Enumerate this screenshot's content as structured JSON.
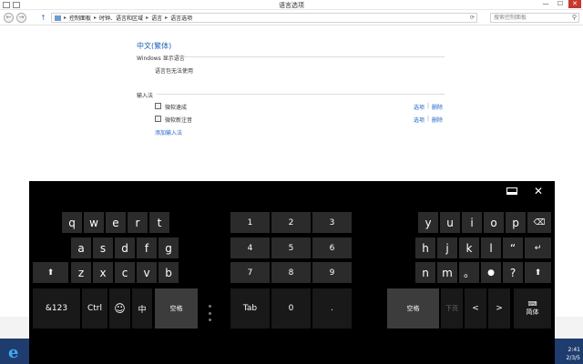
{
  "window": {
    "title": "语言选项",
    "minimize": "—",
    "maximize": "☐",
    "close": "✕"
  },
  "address_bar": {
    "back": "←",
    "forward": "→",
    "up": "↑",
    "crumbs": [
      "控制面板",
      "时钟、语言和区域",
      "语言",
      "语言选项"
    ],
    "separator": "▸",
    "refresh": "⟳",
    "search_placeholder": "搜索控制面板",
    "search_icon": "⚲"
  },
  "language": {
    "title": "中文(繁体)",
    "display_section": "Windows 显示语言",
    "display_status": "语言包无法使用",
    "ime_section": "输入法",
    "ime_items": [
      {
        "name": "微软速成",
        "options": "选项",
        "sep": "|",
        "remove": "删除"
      },
      {
        "name": "微软新注音",
        "options": "选项",
        "sep": "|",
        "remove": "删除"
      }
    ],
    "add_ime": "添加输入法"
  },
  "taskbar": {
    "time": "2:41",
    "date": "2/3/5"
  },
  "keyboard": {
    "left": {
      "row1": [
        "q",
        "w",
        "e",
        "r",
        "t"
      ],
      "row2": [
        "a",
        "s",
        "d",
        "f",
        "g"
      ],
      "row3": [
        "⬆",
        "z",
        "x",
        "c",
        "v",
        "b"
      ],
      "row4": [
        "&123",
        "Ctrl",
        "☺",
        "中",
        "空格"
      ]
    },
    "numpad": {
      "row1": [
        "1",
        "2",
        "3"
      ],
      "row2": [
        "4",
        "5",
        "6"
      ],
      "row3": [
        "7",
        "8",
        "9"
      ],
      "row4": [
        "Tab",
        "0",
        "."
      ]
    },
    "right": {
      "row1": [
        "y",
        "u",
        "i",
        "o",
        "p",
        "⌫"
      ],
      "row2": [
        "h",
        "j",
        "k",
        "l",
        "“",
        "↵"
      ],
      "row3": [
        "n",
        "m",
        "。",
        "●",
        "?",
        "⬆"
      ],
      "row4": [
        "空格",
        "下页",
        "<",
        ">"
      ],
      "switch_top": "⌨",
      "switch_label": "简体"
    },
    "dock_icon": "▭",
    "close_icon": "✕"
  }
}
